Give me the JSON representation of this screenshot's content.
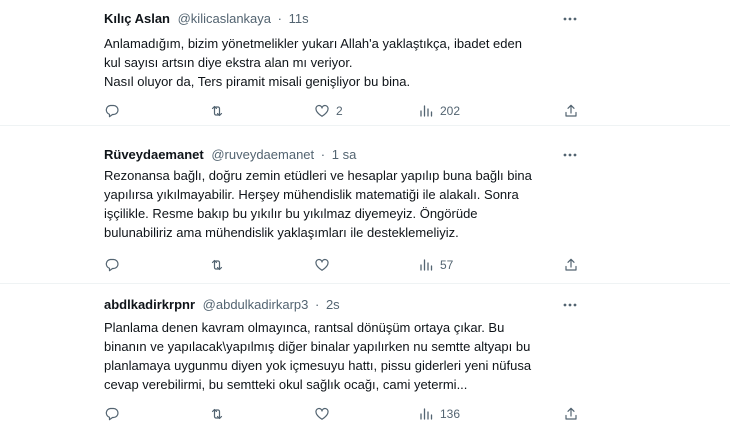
{
  "tweets": [
    {
      "name": "Kılıç Aslan",
      "handle": "@kilicaslankaya",
      "separator": "·",
      "time": "11s",
      "lines": [
        "Anlamadığım, bizim yönetmelikler yukarı Allah'a yaklaştıkça, ibadet eden",
        "kul sayısı artsın diye ekstra alan mı veriyor.",
        "Nasıl oluyor da, Ters piramit misali genişliyor bu bina."
      ],
      "reply_count": "",
      "retweet_count": "",
      "like_count": "2",
      "view_count": "202"
    },
    {
      "name": "Rüveydaemanet",
      "handle": "@ruveydaemanet",
      "separator": "·",
      "time": "1 sa",
      "lines": [
        "Rezonansa bağlı, doğru zemin etüdleri ve hesaplar yapılıp buna bağlı bina",
        "yapılırsa yıkılmayabilir. Herşey mühendislik matematiği ile alakalı. Sonra",
        "işçilikle. Resme bakıp bu yıkılır bu yıkılmaz diyemeyiz. Öngörüde",
        "bulunabiliriz ama mühendislik yaklaşımları ile desteklemeliyiz."
      ],
      "reply_count": "",
      "retweet_count": "",
      "like_count": "",
      "view_count": "57"
    },
    {
      "name": "abdlkadirkrpnr",
      "handle": "@abdulkadirkarp3",
      "separator": "·",
      "time": "2s",
      "lines": [
        "Planlama denen kavram olmayınca, rantsal dönüşüm ortaya çıkar. Bu",
        "binanın ve yapılacak\\yapılmış diğer binalar yapılırken nu semtte altyapı bu",
        "planlamaya uygunmu diyen yok içmesuyu hattı, pissu giderleri yeni nüfusa",
        "cevap verebilirmi, bu semtteki okul sağlık ocağı, cami yetermi..."
      ],
      "reply_count": "",
      "retweet_count": "",
      "like_count": "",
      "view_count": "136"
    }
  ],
  "icons": {
    "more": "more-horizontal-icon",
    "reply": "reply-icon",
    "retweet": "retweet-icon",
    "like": "heart-icon",
    "views": "views-bar-chart-icon",
    "share": "share-icon"
  },
  "colors": {
    "text": "#0f1419",
    "secondary": "#536471",
    "divider": "#eff3f4"
  }
}
